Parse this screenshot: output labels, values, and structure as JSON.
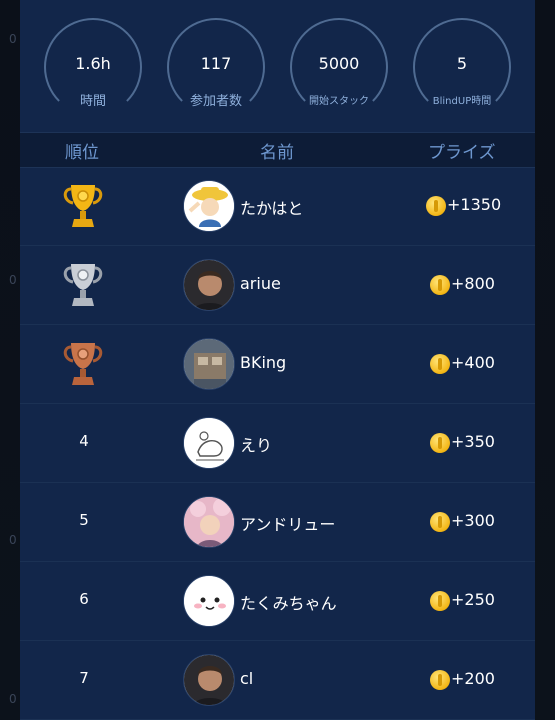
{
  "edge_marks": [
    "0",
    "0",
    "0",
    "0"
  ],
  "stats": [
    {
      "value": "1.6h",
      "label": "時間"
    },
    {
      "value": "117",
      "label": "参加者数"
    },
    {
      "value": "5000",
      "label": "開始スタック"
    },
    {
      "value": "5",
      "label": "BlindUP時間"
    }
  ],
  "header": {
    "rank": "順位",
    "name": "名前",
    "prize": "プライズ"
  },
  "rows": [
    {
      "rank": "",
      "trophy": "gold-trophy-icon",
      "name": "たかはと",
      "prize": "+1350"
    },
    {
      "rank": "",
      "trophy": "silver-trophy-icon",
      "name": "ariue",
      "prize": "+800"
    },
    {
      "rank": "",
      "trophy": "bronze-trophy-icon",
      "name": "BKing",
      "prize": "+400"
    },
    {
      "rank": "4",
      "name": "えり",
      "prize": "+350"
    },
    {
      "rank": "5",
      "name": "アンドリュー",
      "prize": "+300"
    },
    {
      "rank": "6",
      "name": "たくみちゃん",
      "prize": "+250"
    },
    {
      "rank": "7",
      "name": "cl",
      "prize": "+200"
    }
  ],
  "colors": {
    "panel": "#12264a",
    "header_text": "#6e97cf",
    "gold": "#f3b615",
    "silver": "#c9ced6",
    "bronze": "#c8744a"
  }
}
